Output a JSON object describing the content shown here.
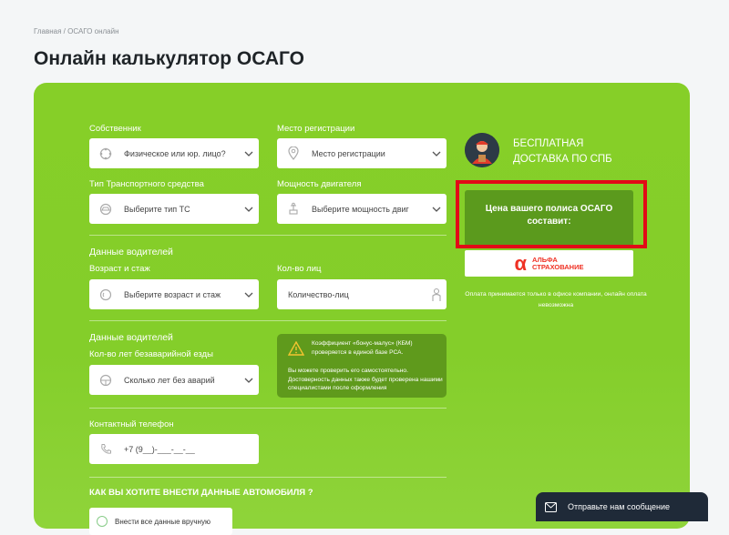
{
  "breadcrumb": {
    "home": "Главная",
    "separator": " / ",
    "current": "ОСАГО онлайн"
  },
  "page_title": "Онлайн калькулятор ОСАГО",
  "form": {
    "owner": {
      "label": "Собственник",
      "value": "Физическое или юр. лицо?",
      "icon": "people-icon"
    },
    "registration": {
      "label": "Место регистрации",
      "value": "Место регистрации",
      "icon": "location-pin-icon"
    },
    "vehicle_type": {
      "label": "Тип Транспортного средства",
      "value": "Выберите тип ТС",
      "icon": "car-icon"
    },
    "engine_power": {
      "label": "Мощность двигателя",
      "value": "Выберите мощность двиг",
      "icon": "engine-icon"
    },
    "drivers_section_1": "Данные водителей",
    "age_experience": {
      "label": "Возраст и стаж",
      "value": "Выберите возраст и стаж",
      "icon": "age-icon"
    },
    "persons_count": {
      "label": "Кол-во лиц",
      "placeholder": "Количество-лиц",
      "icon": "person-icon"
    },
    "drivers_section_2": "Данные водителей",
    "accident_free_years": {
      "label": "Кол-во лет безаварийной езды",
      "value": "Сколько лет без аварий",
      "icon": "steering-icon"
    },
    "phone": {
      "label": "Контактный телефон",
      "placeholder": "+7 (9__)-___-__-__",
      "icon": "phone-icon"
    },
    "car_data_section": "КАК ВЫ ХОТИТЕ ВНЕСТИ ДАННЫЕ АВТОМОБИЛЯ ?",
    "car_data_option": "Внести все данные вручную"
  },
  "kbm_note": {
    "line1": "Коэффициент «бонус-малус» (КБМ) проверяется в единой базе РСА.",
    "line2": "Вы можете проверить его самостоятельно. Достоверность данных также будет проверена нашими специалистами после оформления"
  },
  "delivery": {
    "text": "БЕСПЛАТНАЯ ДОСТАВКА ПО СПБ"
  },
  "price_box": {
    "text": "Цена вашего полиса ОСАГО составит:"
  },
  "insurer": {
    "logo_letter": "α",
    "line1": "АЛЬФА",
    "line2": "СТРАХОВАНИЕ"
  },
  "payment_note": "Оплата принимается только в офисе компании, онлайн оплата невозможна",
  "chat": {
    "label": "Отправьте нам сообщение",
    "icon": "message-icon"
  },
  "colors": {
    "panel_green": "#86cf28",
    "dark_green": "#5b9a1d",
    "highlight_red": "#e20a17",
    "chat_bg": "#1f2a38",
    "alfa_red": "#ef3124"
  }
}
